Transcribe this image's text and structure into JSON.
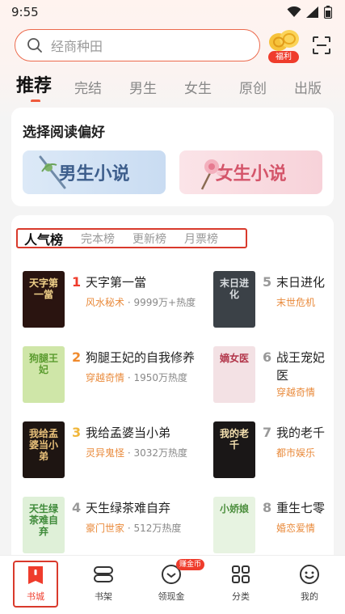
{
  "status_bar": {
    "time": "9:55"
  },
  "search": {
    "placeholder": "经商种田"
  },
  "welfare": {
    "label": "福利"
  },
  "tabs": [
    "推荐",
    "完结",
    "男生",
    "女生",
    "原创",
    "出版"
  ],
  "preference": {
    "title": "选择阅读偏好",
    "male": "男生小说",
    "female": "女生小说"
  },
  "rank_tabs": [
    "人气榜",
    "完本榜",
    "更新榜",
    "月票榜"
  ],
  "books": [
    {
      "rank": "1",
      "title": "天字第一當",
      "category": "风水秘术",
      "heat": "9999万+热度",
      "cover_text": "天字第一當",
      "cover_bg": "#2a1410",
      "cover_fg": "#f2d28a",
      "rank_color": "#ef3c2c"
    },
    {
      "rank": "2",
      "title": "狗腿王妃的自我修养",
      "category": "穿越奇情",
      "heat": "1950万热度",
      "cover_text": "狗腿王妃",
      "cover_bg": "#cfe6a8",
      "cover_fg": "#5a9b2e",
      "rank_color": "#f08a2c"
    },
    {
      "rank": "3",
      "title": "我给孟婆当小弟",
      "category": "灵异鬼怪",
      "heat": "3032万热度",
      "cover_text": "我给孟婆当小弟",
      "cover_bg": "#1e1512",
      "cover_fg": "#e8c07a",
      "rank_color": "#f0b63a"
    },
    {
      "rank": "4",
      "title": "天生绿茶难自弃",
      "category": "豪门世家",
      "heat": "512万热度",
      "cover_text": "天生绿茶难自弃",
      "cover_bg": "#dff0d8",
      "cover_fg": "#3f8a3a",
      "rank_color": "#999999"
    },
    {
      "rank": "5",
      "title": "末日进化",
      "category": "末世危机",
      "heat": "",
      "cover_text": "末日进化",
      "cover_bg": "#3b4147",
      "cover_fg": "#d9dde0",
      "rank_color": "#999999"
    },
    {
      "rank": "6",
      "title": "战王宠妃医",
      "category": "穿越奇情",
      "heat": "",
      "cover_text": "嫡女医",
      "cover_bg": "#f3e1e4",
      "cover_fg": "#b2364a",
      "rank_color": "#999999"
    },
    {
      "rank": "7",
      "title": "我的老千",
      "category": "都市娱乐",
      "heat": "",
      "cover_text": "我的老千",
      "cover_bg": "#1a1717",
      "cover_fg": "#f4e0b0",
      "rank_color": "#999999"
    },
    {
      "rank": "8",
      "title": "重生七零",
      "category": "婚恋爱情",
      "heat": "",
      "cover_text": "小娇娘",
      "cover_bg": "#e7f3e1",
      "cover_fg": "#4d8f3e",
      "rank_color": "#999999"
    }
  ],
  "nav": {
    "items": [
      "书城",
      "书架",
      "领现金",
      "分类",
      "我的"
    ],
    "cash_badge": "赚金币"
  }
}
